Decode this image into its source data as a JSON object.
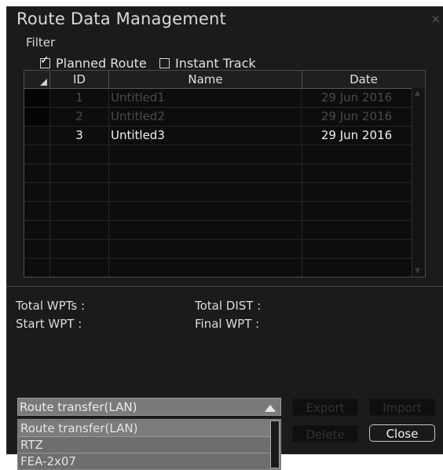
{
  "window": {
    "title": "Route Data Management",
    "close_glyph": "×"
  },
  "filter": {
    "label": "Filter",
    "options": [
      {
        "label": "Planned Route",
        "checked": true
      },
      {
        "label": "Instant Track",
        "checked": false
      }
    ]
  },
  "table": {
    "columns": [
      "ID",
      "Name",
      "Date"
    ],
    "rows": [
      {
        "id": "1",
        "name": "Untitled1",
        "date": "29 Jun 2016",
        "state": "dim"
      },
      {
        "id": "2",
        "name": "Untitled2",
        "date": "29 Jun 2016",
        "state": "dim"
      },
      {
        "id": "3",
        "name": "Untitled3",
        "date": "29 Jun 2016",
        "state": "normal"
      }
    ]
  },
  "info": {
    "total_wpts_label": "Total WPTs :",
    "total_dist_label": "Total DIST :",
    "start_wpt_label": "Start WPT :",
    "final_wpt_label": "Final WPT :"
  },
  "transfer": {
    "selected": "Route transfer(LAN)",
    "options": [
      "Route transfer(LAN)",
      "RTZ",
      "FEA-2x07"
    ]
  },
  "buttons": {
    "export": "Export",
    "import": "Import",
    "delete": "Delete",
    "close": "Close"
  },
  "colors": {
    "dialog_bg": "#1b1b1b",
    "dropdown_bg": "#7a7a7a",
    "dim_text": "#4a4a4a"
  }
}
